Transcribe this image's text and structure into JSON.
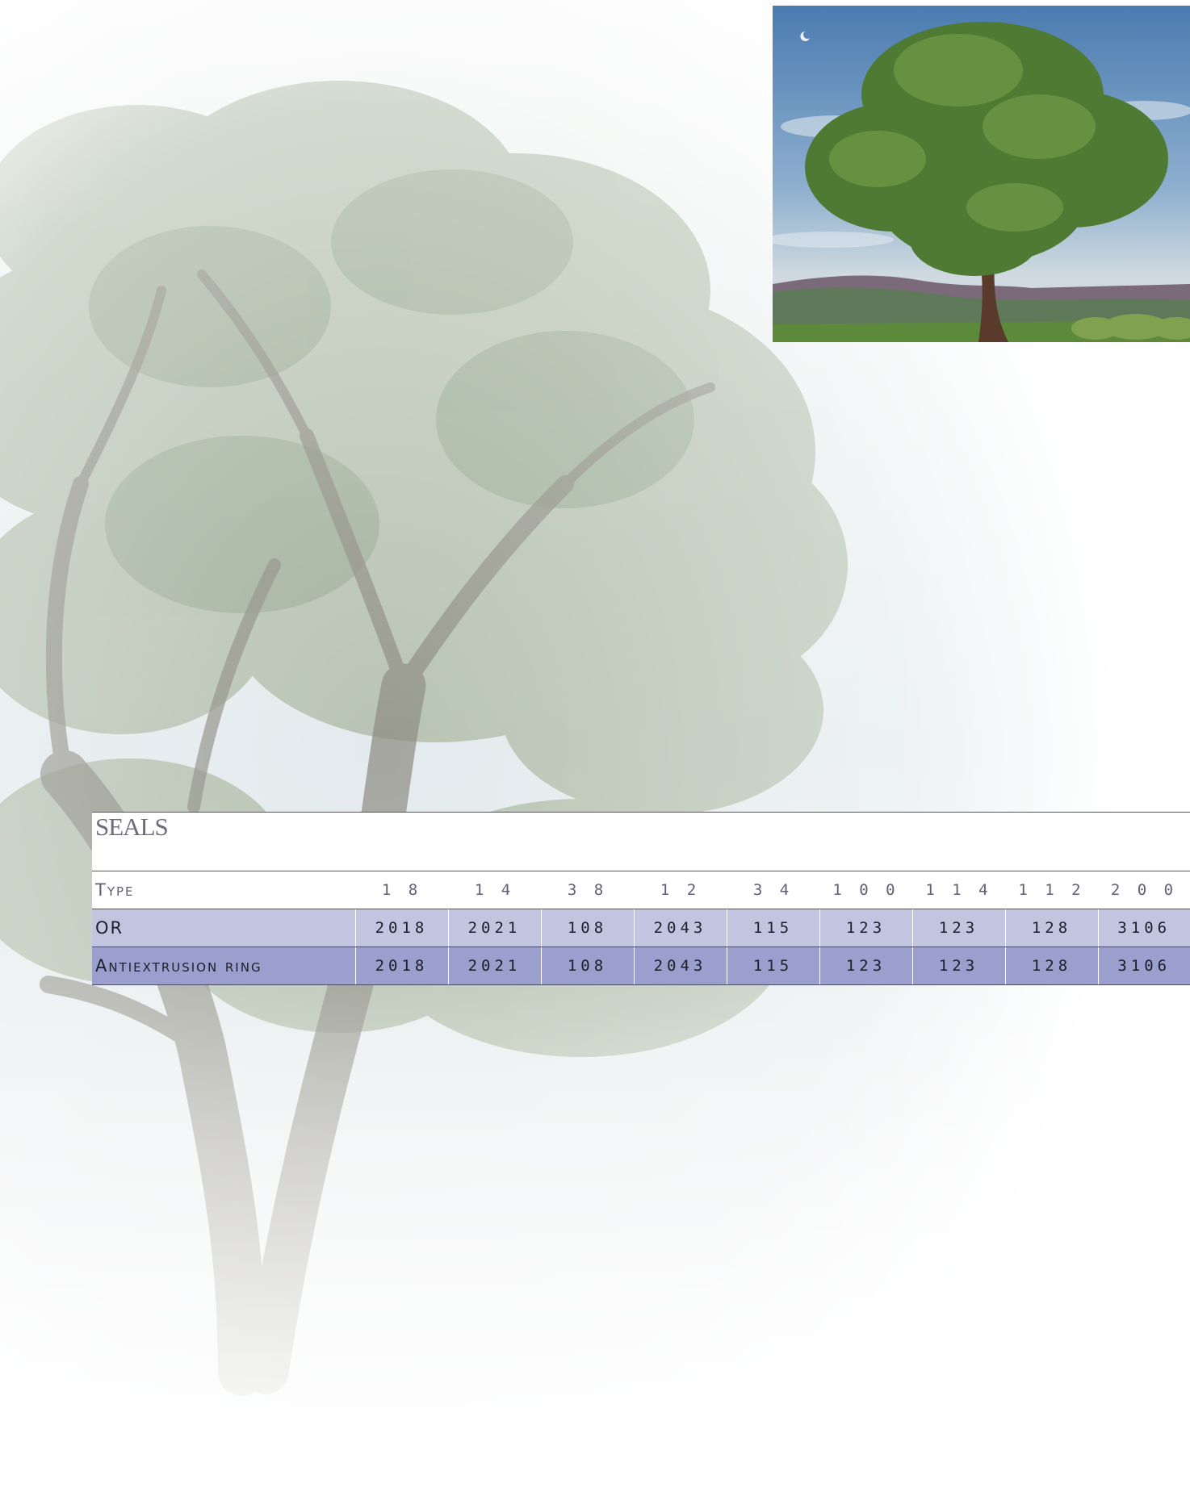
{
  "colors": {
    "header_bg": "#ffffff",
    "row1_bg": "#c2c5e0",
    "row2_bg": "#9a9fcd",
    "rule": "#555555",
    "title": "#6e6e7a"
  },
  "seals": {
    "title": "SEALS",
    "header": [
      "Type",
      "1 8",
      "1 4",
      "3 8",
      "1 2",
      "3 4",
      "1 0 0",
      "1 1 4",
      "1 1 2",
      "2 0 0"
    ],
    "rows": [
      {
        "label": "OR",
        "values": [
          "2018",
          "2021",
          "108",
          "2043",
          "115",
          "123",
          "123",
          "128",
          "3106"
        ]
      },
      {
        "label": "Antiextrusion ring",
        "values": [
          "2018",
          "2021",
          "108",
          "2043",
          "115",
          "123",
          "123",
          "128",
          "3106"
        ]
      }
    ]
  },
  "images": {
    "background": "faded-tree-illustration",
    "photo": "tree-landscape-photo"
  }
}
